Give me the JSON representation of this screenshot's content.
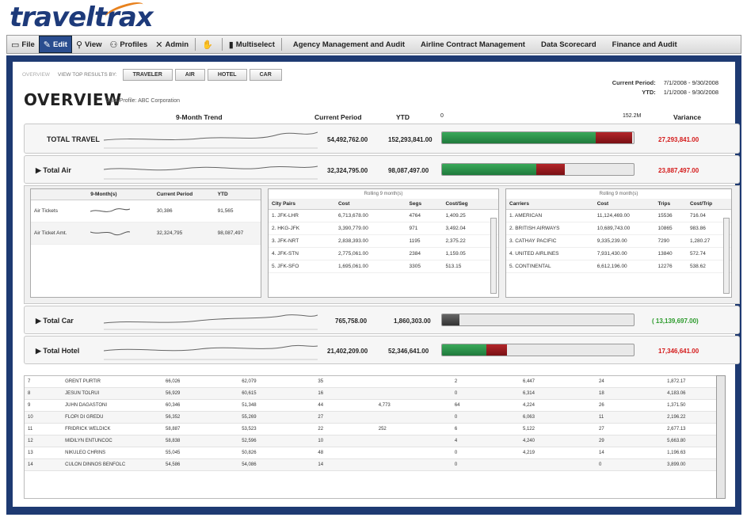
{
  "logo": {
    "text": "traveltrax"
  },
  "menu": {
    "items": [
      {
        "label": "File",
        "icon": "file-icon"
      },
      {
        "label": "Edit",
        "icon": "edit-icon",
        "active": true
      },
      {
        "label": "View",
        "icon": "search-icon"
      },
      {
        "label": "Profiles",
        "icon": "profiles-icon"
      },
      {
        "label": "Admin",
        "icon": "admin-icon"
      }
    ],
    "multiselect": "Multiselect",
    "modules": [
      "Agency Management and Audit",
      "Airline Contract Management",
      "Data Scorecard",
      "Finance and Audit"
    ]
  },
  "tabs": {
    "overview": "OVERVIEW",
    "view_by": "VIEW TOP RESULTS BY:",
    "items": [
      "TRAVELER",
      "AIR",
      "HOTEL",
      "CAR"
    ]
  },
  "page": {
    "title": "OVERVIEW",
    "profile": "Data Profile: ABC Corporation"
  },
  "period": {
    "current_label": "Current Period:",
    "current_value": "7/1/2008 - 9/30/2008",
    "ytd_label": "YTD:",
    "ytd_value": "1/1/2008 - 9/30/2008"
  },
  "columns": {
    "trend": "9-Month Trend",
    "current": "Current Period",
    "ytd": "YTD",
    "scale_min": "0",
    "scale_max": "152.2M",
    "variance": "Variance"
  },
  "colors": {
    "green": "#2a9a4a",
    "red": "#a01a1e",
    "positive": "#2b9a2b",
    "negative": "#d41a1a"
  },
  "summary": [
    {
      "label": "TOTAL TRAVEL",
      "current": "54,492,762.00",
      "ytd": "152,293,841.00",
      "variance": "27,293,841.00",
      "var_sign": "neg",
      "green": 0.8,
      "red": 0.19
    },
    {
      "label": "Total Air",
      "current": "32,324,795.00",
      "ytd": "98,087,497.00",
      "variance": "23,887,497.00",
      "var_sign": "neg",
      "green": 0.49,
      "red": 0.15
    },
    {
      "label": "Total Car",
      "current": "765,758.00",
      "ytd": "1,860,303.00",
      "variance": "( 13,139,697.00)",
      "var_sign": "pos",
      "green": 0.0,
      "red": 0.0,
      "dark": 0.09
    },
    {
      "label": "Total Hotel",
      "current": "21,402,209.00",
      "ytd": "52,346,641.00",
      "variance": "17,346,641.00",
      "var_sign": "neg",
      "green": 0.23,
      "red": 0.11
    }
  ],
  "air_detail": {
    "headers": [
      "9-Month(s)",
      "Current Period",
      "YTD"
    ],
    "rows": [
      {
        "label": "Air Tickets",
        "current": "30,386",
        "ytd": "91,565"
      },
      {
        "label": "Air Ticket Amt.",
        "current": "32,324,795",
        "ytd": "98,087,497"
      }
    ]
  },
  "city_pairs": {
    "caption": "Rolling 9 month(s)",
    "headers": [
      "City Pairs",
      "Cost",
      "Segs",
      "Cost/Seg"
    ],
    "rows": [
      [
        "1. JFK-LHR",
        "6,713,678.00",
        "4764",
        "1,409.25"
      ],
      [
        "2. HKG-JFK",
        "3,390,779.00",
        "971",
        "3,492.04"
      ],
      [
        "3. JFK-NRT",
        "2,838,393.00",
        "1195",
        "2,375.22"
      ],
      [
        "4. JFK-STN",
        "2,775,061.00",
        "2384",
        "1,159.05"
      ],
      [
        "5. JFK-SFO",
        "1,695,061.00",
        "3305",
        "513.15"
      ]
    ]
  },
  "carriers": {
    "caption": "Rolling 9 month(s)",
    "headers": [
      "Carriers",
      "Cost",
      "Trips",
      "Cost/Trip"
    ],
    "rows": [
      [
        "1. AMERICAN",
        "11,124,469.00",
        "15536",
        "716.04"
      ],
      [
        "2. BRITISH AIRWAYS",
        "10,689,743.00",
        "10865",
        "983.86"
      ],
      [
        "3. CATHAY PACIFIC",
        "9,335,239.00",
        "7290",
        "1,280.27"
      ],
      [
        "4. UNITED AIRLINES",
        "7,931,430.00",
        "13840",
        "572.74"
      ],
      [
        "5. CONTINENTAL",
        "6,612,196.00",
        "12276",
        "538.62"
      ]
    ]
  },
  "traveler_rows": [
    [
      "7",
      "GRENT PURTIR",
      "66,026",
      "62,079",
      "35",
      "",
      "2",
      "6,447",
      "24",
      "1,872.17"
    ],
    [
      "8",
      "JESUN TOLRUI",
      "56,929",
      "60,615",
      "16",
      "",
      "0",
      "6,314",
      "18",
      "4,183.06"
    ],
    [
      "9",
      "JUHN DAGASTONI",
      "60,346",
      "51,348",
      "44",
      "4,773",
      "64",
      "4,224",
      "26",
      "1,371.50"
    ],
    [
      "10",
      "FLOPI DI GREDU",
      "56,352",
      "55,269",
      "27",
      "",
      "0",
      "6,063",
      "11",
      "2,196.22"
    ],
    [
      "11",
      "FRIDRICK WELDICK",
      "58,887",
      "53,523",
      "22",
      "252",
      "6",
      "5,122",
      "27",
      "2,677.13"
    ],
    [
      "12",
      "MIDILYN ENTUNCOC",
      "58,838",
      "52,596",
      "10",
      "",
      "4",
      "4,240",
      "29",
      "5,663.80"
    ],
    [
      "13",
      "NIKULEO CHRINS",
      "55,045",
      "50,826",
      "48",
      "",
      "0",
      "4,219",
      "14",
      "1,196.63"
    ],
    [
      "14",
      "CULON DINNOS BENFOLC",
      "54,586",
      "54,086",
      "14",
      "",
      "0",
      "",
      "0",
      "3,899.00"
    ]
  ]
}
